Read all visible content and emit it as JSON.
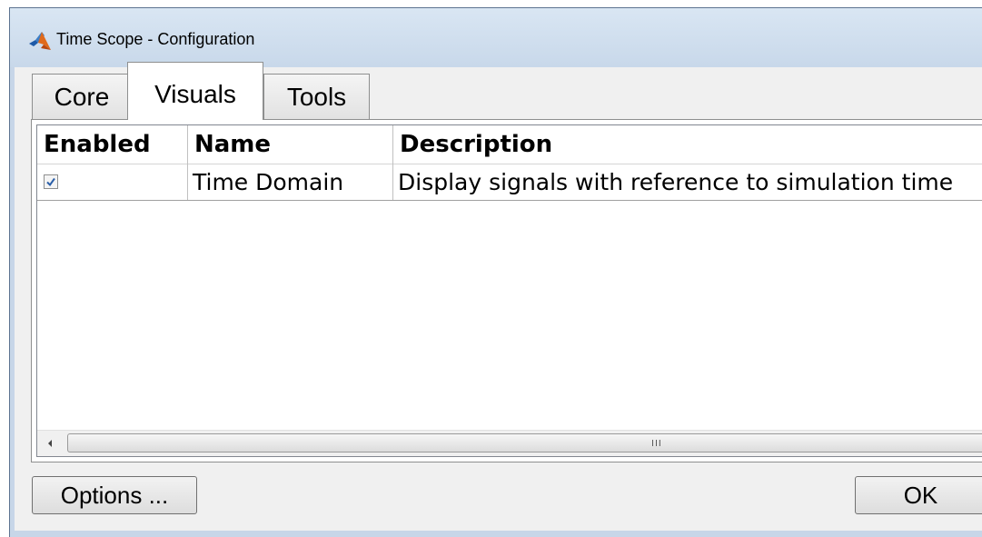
{
  "window": {
    "title": "Time Scope - Configuration",
    "icon": "matlab-icon"
  },
  "tabs": [
    {
      "label": "Core",
      "selected": false
    },
    {
      "label": "Visuals",
      "selected": true
    },
    {
      "label": "Tools",
      "selected": false
    }
  ],
  "table": {
    "columns": [
      "Enabled",
      "Name",
      "Description"
    ],
    "rows": [
      {
        "enabled": true,
        "name": "Time Domain",
        "description": "Display signals with reference to simulation time"
      }
    ]
  },
  "scrollbar": {
    "grip": "III"
  },
  "buttons": {
    "options_label": "Options ...",
    "ok_label": "OK"
  },
  "colors": {
    "titlebar": "#c8d8ea",
    "dialog_bg": "#f0f0f0",
    "checkmark": "#2b5fa8"
  }
}
